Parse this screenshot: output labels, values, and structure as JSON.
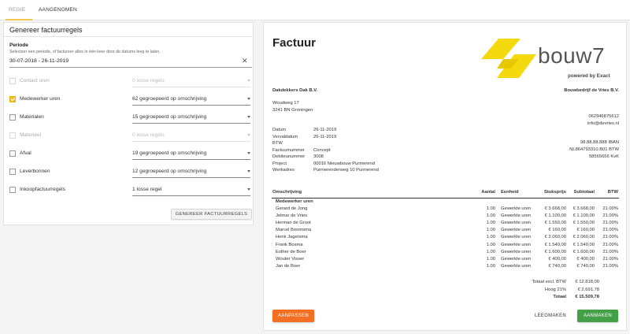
{
  "tabs": [
    {
      "label": "REGIE",
      "active": true
    },
    {
      "label": "AANGENOMEN",
      "active": false
    }
  ],
  "generator": {
    "title": "Genereer factuurregels",
    "periode_label": "Periode",
    "periode_hint": "Selecteer een periode, of factureer alles in één keer door de datums leeg te laten.",
    "periode_value": "30-07-2018 - 26-11-2019",
    "rows": [
      {
        "label": "Contact uren",
        "value": "0 losse regels",
        "checked": false,
        "disabled": true
      },
      {
        "label": "Medewerker uren",
        "value": "62 gegroepeerd op omschrijving",
        "checked": true,
        "disabled": false
      },
      {
        "label": "Materialen",
        "value": "15 gegroepeerd op omschrijving",
        "checked": false,
        "disabled": false
      },
      {
        "label": "Materieel",
        "value": "0 losse regels",
        "checked": false,
        "disabled": true
      },
      {
        "label": "Afval",
        "value": "19 gegroepeerd op omschrijving",
        "checked": false,
        "disabled": false
      },
      {
        "label": "Leverbonnen",
        "value": "12 gegroepeerd op omschrijving",
        "checked": false,
        "disabled": false
      },
      {
        "label": "Inkoopfactuurregels",
        "value": "1 losse regel",
        "checked": false,
        "disabled": false
      }
    ],
    "generate_button": "GENEREER FACTUURREGELS"
  },
  "invoice": {
    "title": "Factuur",
    "logo": {
      "text": "bouw7",
      "sub": "powered by Exact",
      "color": "#f5d90f"
    },
    "client_name": "Dakdekkers Dak B.V.",
    "client_street": "Woudweg 17",
    "client_city": "3241 BN Groningen",
    "company_name": "Bouwbedrijf de Vries B.V.",
    "company_phone": "062946875612",
    "company_email": "info@devries.nl",
    "company_iban": "98.88.88.888 IBAN",
    "company_btw": "NL864793310.B01 BTW",
    "company_kvk": "58565656  KvK",
    "meta": [
      {
        "label": "Datum",
        "value": "26-11-2019"
      },
      {
        "label": "Vervaldatum",
        "value": "26-11-2019"
      },
      {
        "label": "BTW",
        "value": ""
      },
      {
        "label": "Factuurnummer",
        "value": "Concept"
      },
      {
        "label": "Debiteunummer",
        "value": "3008"
      },
      {
        "label": "Project",
        "value": "00016 Nieuwbouw Purmerend"
      },
      {
        "label": "Werkadres",
        "value": "Purmerenderweg 10 Purmerend"
      }
    ],
    "columns": {
      "omschrijving": "Omschrijving",
      "aantal": "Aantal",
      "eenheid": "Eenheid",
      "stuksprijs": "Stuksprijs",
      "subtotaal": "Subtotaal",
      "btw": "BTW"
    },
    "group_title": "Medewerker uren",
    "lines": [
      {
        "omschrijving": "Gerard de Jong",
        "aantal": "1.00",
        "eenheid": "Gewerkte uren",
        "stuksprijs": "€ 3.668,00",
        "subtotaal": "€ 3.668,00",
        "btw": "21.00%"
      },
      {
        "omschrijving": "Jelmar de Vries",
        "aantal": "1.00",
        "eenheid": "Gewerkte uren",
        "stuksprijs": "€ 1.100,00",
        "subtotaal": "€ 1.100,00",
        "btw": "21.00%"
      },
      {
        "omschrijving": "Herman de Groot",
        "aantal": "1.00",
        "eenheid": "Gewerkte uren",
        "stuksprijs": "€ 1.550,00",
        "subtotaal": "€ 1.550,00",
        "btw": "21.00%"
      },
      {
        "omschrijving": "Marcel Boomsma",
        "aantal": "1.00",
        "eenheid": "Gewerkte uren",
        "stuksprijs": "€ 160,00",
        "subtotaal": "€ 160,00",
        "btw": "21.00%"
      },
      {
        "omschrijving": "Henk Jagersma",
        "aantal": "1.00",
        "eenheid": "Gewerkte uren",
        "stuksprijs": "€ 2.060,00",
        "subtotaal": "€ 2.060,00",
        "btw": "21.00%"
      },
      {
        "omschrijving": "Frank Bosma",
        "aantal": "1.00",
        "eenheid": "Gewerkte uren",
        "stuksprijs": "€ 1.540,00",
        "subtotaal": "€ 1.540,00",
        "btw": "21.00%"
      },
      {
        "omschrijving": "Esther de Boer",
        "aantal": "1.00",
        "eenheid": "Gewerkte uren",
        "stuksprijs": "€ 1.600,00",
        "subtotaal": "€ 1.600,00",
        "btw": "21.00%"
      },
      {
        "omschrijving": "Wouter Visser",
        "aantal": "1.00",
        "eenheid": "Gewerkte uren",
        "stuksprijs": "€ 400,00",
        "subtotaal": "€ 400,00",
        "btw": "21.00%"
      },
      {
        "omschrijving": "Jan de Boer",
        "aantal": "1.00",
        "eenheid": "Gewerkte uren",
        "stuksprijs": "€ 740,00",
        "subtotaal": "€ 740,00",
        "btw": "21.00%"
      }
    ],
    "totals": [
      {
        "label": "Totaal excl. BTW",
        "value": "€ 12.818,00",
        "bold": false
      },
      {
        "label": "Hoog 21%",
        "value": "€ 2.691,78",
        "bold": false
      },
      {
        "label": "Totaal",
        "value": "€ 15.509,78",
        "bold": true
      }
    ],
    "buttons": {
      "aanpassen": "AANPASSEN",
      "leegmaken": "LEEGMAKEN",
      "aanmaken": "AANMAKEN"
    }
  },
  "colors": {
    "accent": "#f2c94c",
    "orange": "#f36f21",
    "green": "#43a047"
  }
}
